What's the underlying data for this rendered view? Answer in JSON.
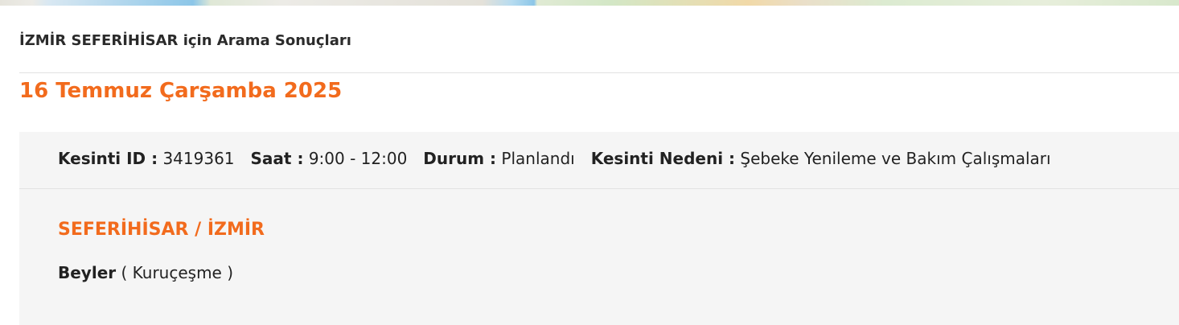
{
  "header": {
    "city": "İZMİR SEFERİHİSAR",
    "suffix": "için Arama Sonuçları"
  },
  "date_title": "16 Temmuz Çarşamba 2025",
  "outage": {
    "id_label": "Kesinti ID :",
    "id_value": "3419361",
    "time_label": "Saat :",
    "time_value": "9:00 - 12:00",
    "status_label": "Durum :",
    "status_value": "Planlandı",
    "reason_label": "Kesinti Nedeni :",
    "reason_value": "Şebeke Yenileme ve Bakım Çalışmaları",
    "location_title": "SEFERİHİSAR / İZMİR",
    "district": "Beyler",
    "neighborhood": "( Kuruçeşme )"
  }
}
